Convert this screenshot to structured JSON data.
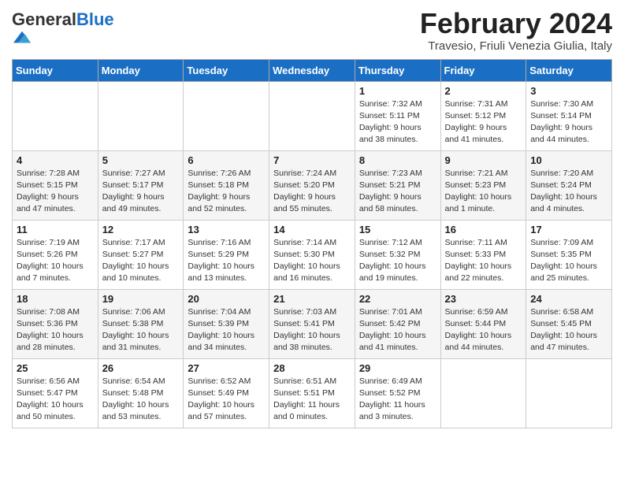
{
  "header": {
    "logo_general": "General",
    "logo_blue": "Blue",
    "title": "February 2024",
    "subtitle": "Travesio, Friuli Venezia Giulia, Italy"
  },
  "weekdays": [
    "Sunday",
    "Monday",
    "Tuesday",
    "Wednesday",
    "Thursday",
    "Friday",
    "Saturday"
  ],
  "weeks": [
    [
      {
        "day": "",
        "info": ""
      },
      {
        "day": "",
        "info": ""
      },
      {
        "day": "",
        "info": ""
      },
      {
        "day": "",
        "info": ""
      },
      {
        "day": "1",
        "info": "Sunrise: 7:32 AM\nSunset: 5:11 PM\nDaylight: 9 hours\nand 38 minutes."
      },
      {
        "day": "2",
        "info": "Sunrise: 7:31 AM\nSunset: 5:12 PM\nDaylight: 9 hours\nand 41 minutes."
      },
      {
        "day": "3",
        "info": "Sunrise: 7:30 AM\nSunset: 5:14 PM\nDaylight: 9 hours\nand 44 minutes."
      }
    ],
    [
      {
        "day": "4",
        "info": "Sunrise: 7:28 AM\nSunset: 5:15 PM\nDaylight: 9 hours\nand 47 minutes."
      },
      {
        "day": "5",
        "info": "Sunrise: 7:27 AM\nSunset: 5:17 PM\nDaylight: 9 hours\nand 49 minutes."
      },
      {
        "day": "6",
        "info": "Sunrise: 7:26 AM\nSunset: 5:18 PM\nDaylight: 9 hours\nand 52 minutes."
      },
      {
        "day": "7",
        "info": "Sunrise: 7:24 AM\nSunset: 5:20 PM\nDaylight: 9 hours\nand 55 minutes."
      },
      {
        "day": "8",
        "info": "Sunrise: 7:23 AM\nSunset: 5:21 PM\nDaylight: 9 hours\nand 58 minutes."
      },
      {
        "day": "9",
        "info": "Sunrise: 7:21 AM\nSunset: 5:23 PM\nDaylight: 10 hours\nand 1 minute."
      },
      {
        "day": "10",
        "info": "Sunrise: 7:20 AM\nSunset: 5:24 PM\nDaylight: 10 hours\nand 4 minutes."
      }
    ],
    [
      {
        "day": "11",
        "info": "Sunrise: 7:19 AM\nSunset: 5:26 PM\nDaylight: 10 hours\nand 7 minutes."
      },
      {
        "day": "12",
        "info": "Sunrise: 7:17 AM\nSunset: 5:27 PM\nDaylight: 10 hours\nand 10 minutes."
      },
      {
        "day": "13",
        "info": "Sunrise: 7:16 AM\nSunset: 5:29 PM\nDaylight: 10 hours\nand 13 minutes."
      },
      {
        "day": "14",
        "info": "Sunrise: 7:14 AM\nSunset: 5:30 PM\nDaylight: 10 hours\nand 16 minutes."
      },
      {
        "day": "15",
        "info": "Sunrise: 7:12 AM\nSunset: 5:32 PM\nDaylight: 10 hours\nand 19 minutes."
      },
      {
        "day": "16",
        "info": "Sunrise: 7:11 AM\nSunset: 5:33 PM\nDaylight: 10 hours\nand 22 minutes."
      },
      {
        "day": "17",
        "info": "Sunrise: 7:09 AM\nSunset: 5:35 PM\nDaylight: 10 hours\nand 25 minutes."
      }
    ],
    [
      {
        "day": "18",
        "info": "Sunrise: 7:08 AM\nSunset: 5:36 PM\nDaylight: 10 hours\nand 28 minutes."
      },
      {
        "day": "19",
        "info": "Sunrise: 7:06 AM\nSunset: 5:38 PM\nDaylight: 10 hours\nand 31 minutes."
      },
      {
        "day": "20",
        "info": "Sunrise: 7:04 AM\nSunset: 5:39 PM\nDaylight: 10 hours\nand 34 minutes."
      },
      {
        "day": "21",
        "info": "Sunrise: 7:03 AM\nSunset: 5:41 PM\nDaylight: 10 hours\nand 38 minutes."
      },
      {
        "day": "22",
        "info": "Sunrise: 7:01 AM\nSunset: 5:42 PM\nDaylight: 10 hours\nand 41 minutes."
      },
      {
        "day": "23",
        "info": "Sunrise: 6:59 AM\nSunset: 5:44 PM\nDaylight: 10 hours\nand 44 minutes."
      },
      {
        "day": "24",
        "info": "Sunrise: 6:58 AM\nSunset: 5:45 PM\nDaylight: 10 hours\nand 47 minutes."
      }
    ],
    [
      {
        "day": "25",
        "info": "Sunrise: 6:56 AM\nSunset: 5:47 PM\nDaylight: 10 hours\nand 50 minutes."
      },
      {
        "day": "26",
        "info": "Sunrise: 6:54 AM\nSunset: 5:48 PM\nDaylight: 10 hours\nand 53 minutes."
      },
      {
        "day": "27",
        "info": "Sunrise: 6:52 AM\nSunset: 5:49 PM\nDaylight: 10 hours\nand 57 minutes."
      },
      {
        "day": "28",
        "info": "Sunrise: 6:51 AM\nSunset: 5:51 PM\nDaylight: 11 hours\nand 0 minutes."
      },
      {
        "day": "29",
        "info": "Sunrise: 6:49 AM\nSunset: 5:52 PM\nDaylight: 11 hours\nand 3 minutes."
      },
      {
        "day": "",
        "info": ""
      },
      {
        "day": "",
        "info": ""
      }
    ]
  ]
}
